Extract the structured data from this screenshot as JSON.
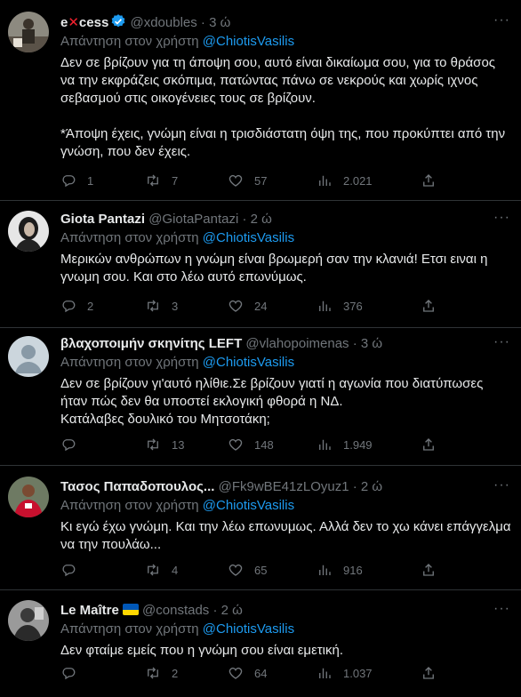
{
  "tweets": [
    {
      "name_pre": "e",
      "name_mark": "✕",
      "name_post": "cess",
      "handle": "@xdoubles",
      "sep": "·",
      "time": "3 ώ",
      "reply_prefix": "Απάντηση στον χρήστη",
      "mention": "@ChiotisVasilis",
      "paragraphs": [
        "Δεν σε βρίζουν για τη άποψη σου, αυτό είναι δικαίωμα σου, για το θράσος να την εκφράζεις σκόπιμα, πατώντας πάνω σε νεκρούς και χωρίς ιχνος σεβασμού στις οικογένειες τους σε βρίζουν.",
        "*Άποψη έχεις, γνώμη είναι η τρισδιάστατη όψη της, που προκύπτει από την γνώση, που δεν έχεις."
      ],
      "replies": "1",
      "retweets": "7",
      "likes": "57",
      "views": "2.021",
      "avatar_color": "#6b6358"
    },
    {
      "name": "Giota Pantazi",
      "handle": "@GiotaPantazi",
      "sep": "·",
      "time": "2 ώ",
      "reply_prefix": "Απάντηση στον χρήστη",
      "mention": "@ChiotisVasilis",
      "paragraphs": [
        "Μερικών ανθρώπων η γνώμη είναι βρωμερή σαν την κλανιά! Ετσι ειναι η γνωμη σου. Και στο λέω αυτό επωνύμως."
      ],
      "replies": "2",
      "retweets": "3",
      "likes": "24",
      "views": "376",
      "avatar_color": "#d9d9d9"
    },
    {
      "name": "βλαχοποιμήν σκηνίτης LEFT",
      "handle": "@vlahopoimenas",
      "sep": "·",
      "time": "3 ώ",
      "reply_prefix": "Απάντηση στον χρήστη",
      "mention": "@ChiotisVasilis",
      "paragraphs": [
        "Δεν σε βρίζουν γι'αυτό ηλίθιε.Σε βρίζουν γιατί η αγωνία που διατύπωσες ήταν πώς δεν θα υποστεί εκλογική φθορά η ΝΔ.",
        "Κατάλαβες δουλικό του Μητσοτάκη;"
      ],
      "replies": "",
      "retweets": "13",
      "likes": "148",
      "views": "1.949",
      "avatar_color": "#ccd6dd"
    },
    {
      "name": "Τασος Παπαδοπουλος...",
      "handle": "@Fk9wBE41zLOyuz1",
      "sep": "·",
      "time": "2 ώ",
      "reply_prefix": "Απάντηση στον χρήστη",
      "mention": "@ChiotisVasilis",
      "paragraphs": [
        "Κι εγώ έχω γνώμη. Και την λέω επωνυμως.  Αλλά δεν το χω κάνει επάγγελμα να την πουλάω..."
      ],
      "replies": "",
      "retweets": "4",
      "likes": "65",
      "views": "916",
      "avatar_color": "#b3261e"
    },
    {
      "name": "Le Maître",
      "handle": "@constads",
      "sep": "·",
      "time": "2 ώ",
      "reply_prefix": "Απάντηση στον χρήστη",
      "mention": "@ChiotisVasilis",
      "paragraphs": [
        "Δεν φταίμε εμείς που η γνώμη σου είναι εμετική."
      ],
      "replies": "",
      "retweets": "2",
      "likes": "64",
      "views": "1.037",
      "avatar_color": "#444444"
    }
  ],
  "icons": {
    "verified": "verified-badge-icon",
    "more": "more-icon",
    "reply": "reply-icon",
    "retweet": "retweet-icon",
    "like": "like-icon",
    "views": "views-icon",
    "share": "share-icon"
  },
  "more_glyph": "···",
  "colors": {
    "accent": "#1d9bf0",
    "muted": "#71767b",
    "text": "#e7e9ea",
    "divider": "#2f3336",
    "flag_blue": "#0057b7",
    "flag_yellow": "#ffd700"
  }
}
